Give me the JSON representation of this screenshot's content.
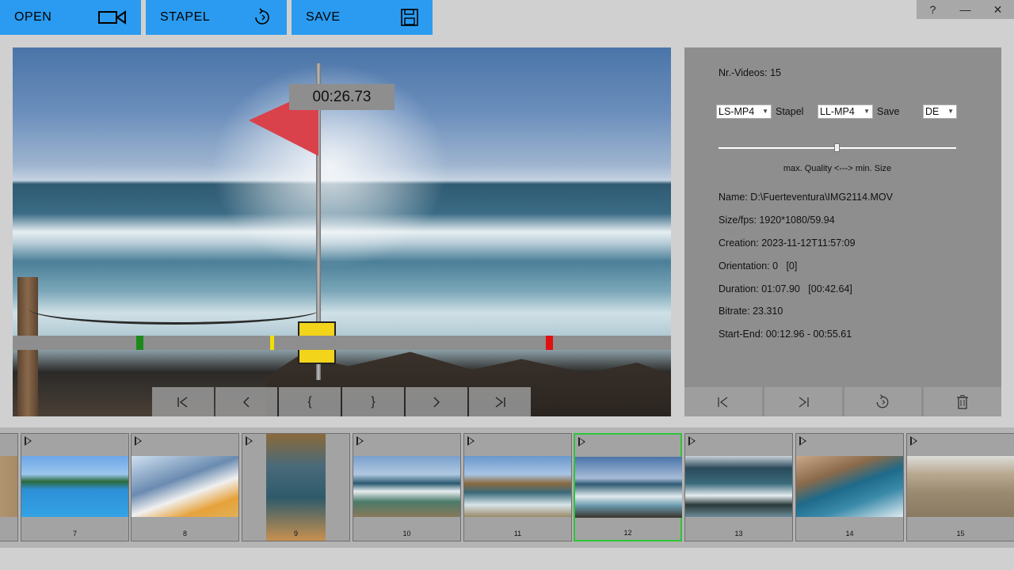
{
  "toolbar": {
    "open_label": "OPEN",
    "stapel_label": "STAPEL",
    "save_label": "SAVE",
    "accent": "#2a9bf0"
  },
  "window": {
    "help": "?",
    "minimize": "—",
    "close": "✕"
  },
  "player": {
    "timecode": "00:26.73",
    "controls": [
      "|◁",
      "<",
      "{",
      "}",
      ">",
      "▷|"
    ],
    "markers": [
      {
        "color": "#1a8a1a"
      },
      {
        "color": "#f0e000"
      },
      {
        "color": "#e01010"
      }
    ]
  },
  "panel": {
    "nr_videos": "Nr.-Videos: 15",
    "select1": "LS-MP4",
    "select1_label": "Stapel",
    "select2": "LL-MP4",
    "select2_label": "Save",
    "select3": "DE",
    "slider_value": 0.5,
    "slider_caption": "max. Quality <---> min. Size",
    "name": "Name: D:\\Fuerteventura\\IMG2114.MOV",
    "size_fps": "Size/fps: 1920*1080/59.94",
    "creation": "Creation: 2023-11-12T11:57:09",
    "orientation": "Orientation: 0   [0]",
    "duration": "Duration: 01:07.90   [00:42.64]",
    "bitrate": "Bitrate: 23.310",
    "start_end": "Start-End: 00:12.96 - 00:55.61"
  },
  "thumbnails": [
    {
      "num": "7"
    },
    {
      "num": "8"
    },
    {
      "num": "9"
    },
    {
      "num": "10"
    },
    {
      "num": "11"
    },
    {
      "num": "12"
    },
    {
      "num": "13"
    },
    {
      "num": "14"
    },
    {
      "num": "15"
    }
  ],
  "selected_thumbnail": "12"
}
